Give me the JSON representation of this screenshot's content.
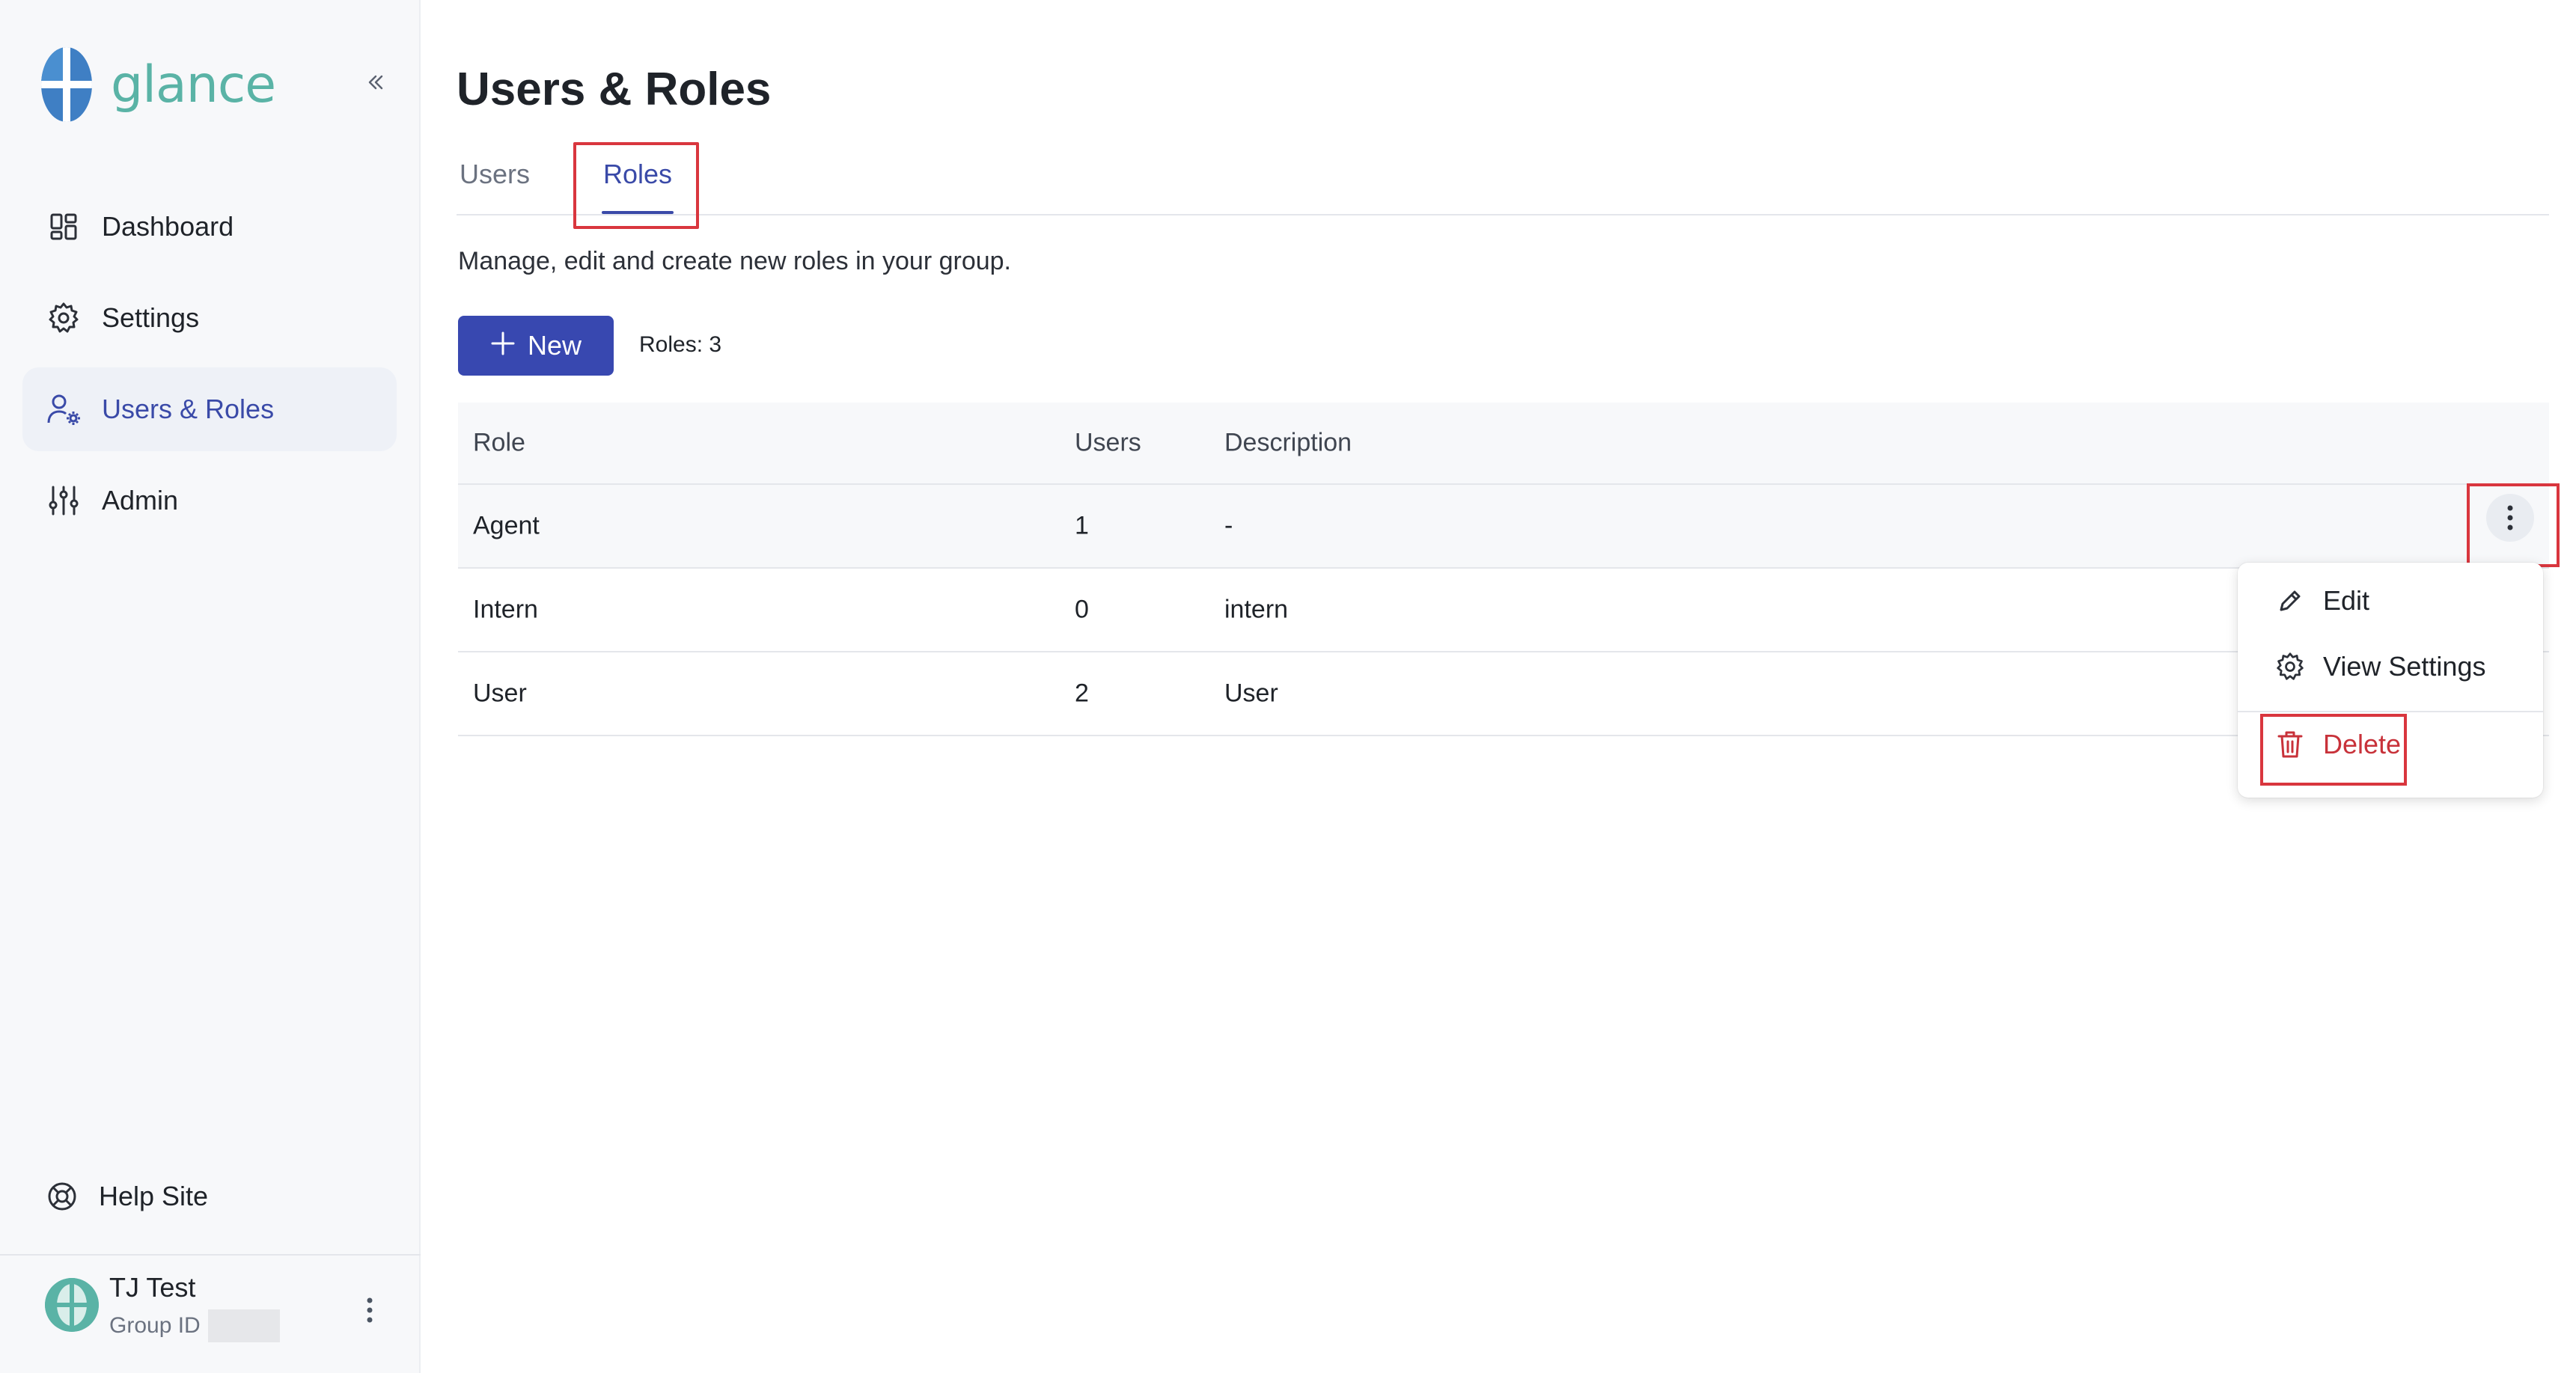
{
  "app": {
    "logo_text": "glance",
    "colors": {
      "brand": "#5ab3a6",
      "accent": "#3a4aa8",
      "primary_button": "#3848b0",
      "danger": "#c8323a"
    }
  },
  "sidebar": {
    "collapse_icon": "double-chevron-left-icon",
    "items": [
      {
        "label": "Dashboard",
        "icon": "dashboard-icon"
      },
      {
        "label": "Settings",
        "icon": "gear-icon"
      },
      {
        "label": "Users & Roles",
        "icon": "users-gear-icon",
        "active": true
      },
      {
        "label": "Admin",
        "icon": "sliders-icon"
      }
    ],
    "help": {
      "label": "Help Site",
      "icon": "lifebuoy-icon"
    },
    "profile": {
      "name": "TJ Test",
      "group_label": "Group ID"
    }
  },
  "page": {
    "title": "Users & Roles",
    "tabs": [
      {
        "label": "Users",
        "active": false
      },
      {
        "label": "Roles",
        "active": true
      }
    ],
    "subtitle": "Manage, edit and create new roles in your group.",
    "new_button": "New",
    "roles_count": "Roles: 3"
  },
  "table": {
    "headers": [
      "Role",
      "Users",
      "Description"
    ],
    "rows": [
      {
        "role": "Agent",
        "users": "1",
        "description": "-"
      },
      {
        "role": "Intern",
        "users": "0",
        "description": "intern"
      },
      {
        "role": "User",
        "users": "2",
        "description": "User"
      }
    ]
  },
  "row_menu": {
    "icon": "more-vertical-icon",
    "items": [
      {
        "label": "Edit",
        "icon": "pencil-icon"
      },
      {
        "label": "View Settings",
        "icon": "gear-icon"
      },
      {
        "label": "Delete",
        "icon": "trash-icon"
      }
    ]
  }
}
